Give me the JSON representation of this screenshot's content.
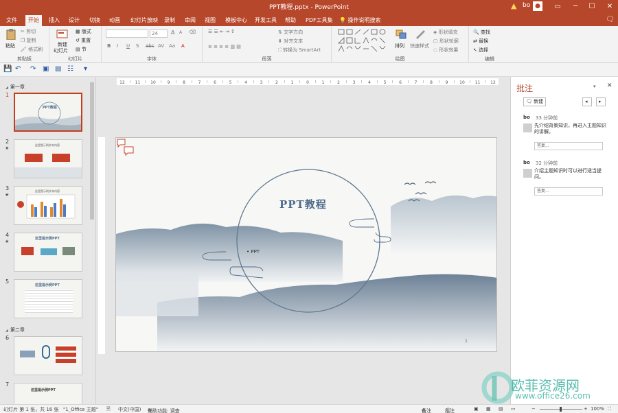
{
  "titlebar": {
    "title": "PPT教程.pptx  -  PowerPoint",
    "user": "bo",
    "min": "─",
    "max": "☐",
    "close": "✕"
  },
  "tabs": [
    "文件",
    "开始",
    "插入",
    "设计",
    "切换",
    "动画",
    "幻灯片放映",
    "录制",
    "审阅",
    "视图",
    "模板中心",
    "开发工具",
    "帮助",
    "PDF工具集"
  ],
  "tell_me": "操作说明搜索",
  "ribbon": {
    "clipboard": {
      "label": "剪贴板",
      "paste": "粘贴",
      "cut": "剪切",
      "copy": "复制",
      "format": "格式刷"
    },
    "slides": {
      "label": "幻灯片",
      "new": "新建",
      "new2": "幻灯片",
      "layout": "版式",
      "reset": "重置",
      "section": "节"
    },
    "font": {
      "label": "字体",
      "size": "24",
      "bold": "B",
      "italic": "I",
      "underline": "U",
      "strike": "S",
      "ab": "abc",
      "aa": "Aa",
      "a_big": "A",
      "a_small": "A"
    },
    "paragraph": {
      "label": "段落",
      "dir": "文字方向",
      "align": "对齐文本",
      "smartart": "转换为 SmartArt"
    },
    "drawing": {
      "label": "绘图",
      "arrange": "排列",
      "quickstyle": "快速样式",
      "fill": "形状填充",
      "outline": "形状轮廓",
      "effect": "形状效果"
    },
    "editing": {
      "label": "编辑",
      "find": "查找",
      "replace": "替换",
      "select": "选择"
    }
  },
  "thumbs": {
    "section1": "第一章",
    "section2": "第二章",
    "slides": [
      {
        "num": "1",
        "title": "PPT教程"
      },
      {
        "num": "2",
        "title": "这里是示例文本内容"
      },
      {
        "num": "3",
        "title": "这里是示例文本内容"
      },
      {
        "num": "4",
        "title": "这里是示例PPT"
      },
      {
        "num": "5",
        "title": "这里是示例PPT"
      },
      {
        "num": "6",
        "title": ""
      },
      {
        "num": "7",
        "title": "这里是示例PPT"
      }
    ]
  },
  "slide": {
    "title": "PPT教程",
    "subtitle": "PPT",
    "page": "1"
  },
  "ruler": {
    "h": [
      "12",
      "11",
      "10",
      "9",
      "8",
      "7",
      "6",
      "5",
      "4",
      "3",
      "2",
      "1",
      "0",
      "1",
      "2",
      "3",
      "4",
      "5",
      "6",
      "7",
      "8",
      "9",
      "10",
      "11",
      "12"
    ]
  },
  "comments": {
    "title": "批注",
    "new": "新建",
    "items": [
      {
        "author": "bo",
        "time": "33 分钟前",
        "text": "先介绍背景知识，再进入主题知识的讲解。",
        "reply": "答复..."
      },
      {
        "author": "bo",
        "time": "32 分钟前",
        "text": "介绍主题知识时可以进行适当提问。",
        "reply": "答复..."
      }
    ]
  },
  "status": {
    "slide": "幻灯片 第 1 张，共 16 张",
    "theme": "\"1_Office 主题\"",
    "lang": "中文(中国)",
    "access": "辅助功能: 调查",
    "notes": "备注",
    "comments": "批注",
    "zoom": "100%"
  },
  "watermark": {
    "text": "欧菲资源网",
    "url": "www.office26.com"
  },
  "colors": {
    "accent": "#b7472a",
    "slide_active": "#c43e1c",
    "ink": "#4d6b8a"
  }
}
